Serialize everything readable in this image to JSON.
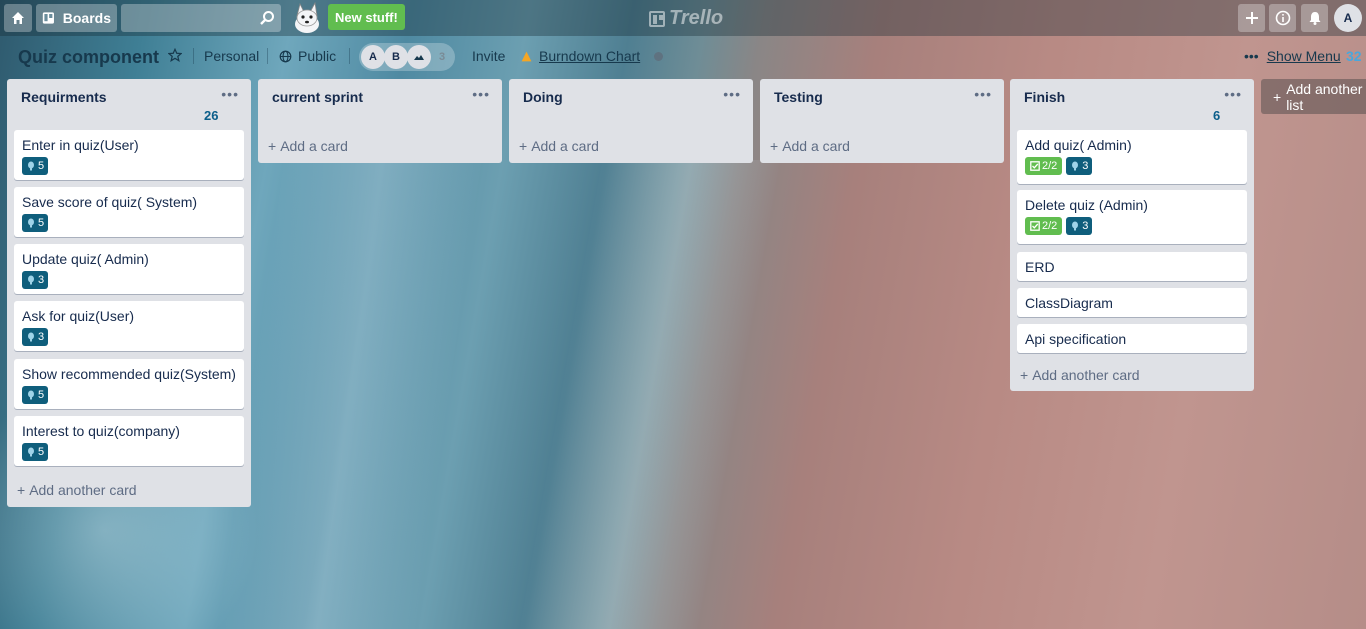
{
  "header": {
    "boards_label": "Boards",
    "search_placeholder": "",
    "new_stuff_label": "New stuff!",
    "logo_text": "Trello",
    "user_initial": "A"
  },
  "board": {
    "title": "Quiz component",
    "team_label": "Personal",
    "visibility_label": "Public",
    "members": [
      "A",
      "B"
    ],
    "more_members_count": "3",
    "invite_label": "Invite",
    "powerup_label": "Burndown Chart",
    "show_menu_label": "Show Menu",
    "menu_count": "32"
  },
  "lists": [
    {
      "title": "Requirments",
      "count": "26",
      "cards": [
        {
          "title": "Enter in quiz(User)",
          "points": "5"
        },
        {
          "title": "Save score of quiz( System)",
          "points": "5"
        },
        {
          "title": "Update quiz( Admin)",
          "points": "3"
        },
        {
          "title": "Ask for quiz(User)",
          "points": "3"
        },
        {
          "title": "Show recommended quiz(System)",
          "points": "5"
        },
        {
          "title": "Interest to quiz(company)",
          "points": "5"
        }
      ],
      "add_label": "Add another card"
    },
    {
      "title": "current sprint",
      "cards": [],
      "add_label": "Add a card"
    },
    {
      "title": "Doing",
      "cards": [],
      "add_label": "Add a card"
    },
    {
      "title": "Testing",
      "cards": [],
      "add_label": "Add a card"
    },
    {
      "title": "Finish",
      "count": "6",
      "cards": [
        {
          "title": "Add quiz( Admin)",
          "checklist": "2/2",
          "points": "3"
        },
        {
          "title": "Delete quiz (Admin)",
          "checklist": "2/2",
          "points": "3"
        },
        {
          "title": "ERD"
        },
        {
          "title": "ClassDiagram"
        },
        {
          "title": "Api specification"
        }
      ],
      "add_label": "Add another card"
    }
  ],
  "add_list_label": "Add another list",
  "colors": {
    "accent_green": "#61bd4f",
    "points_badge": "#0f5e7c",
    "list_bg": "#dfe1e6"
  }
}
